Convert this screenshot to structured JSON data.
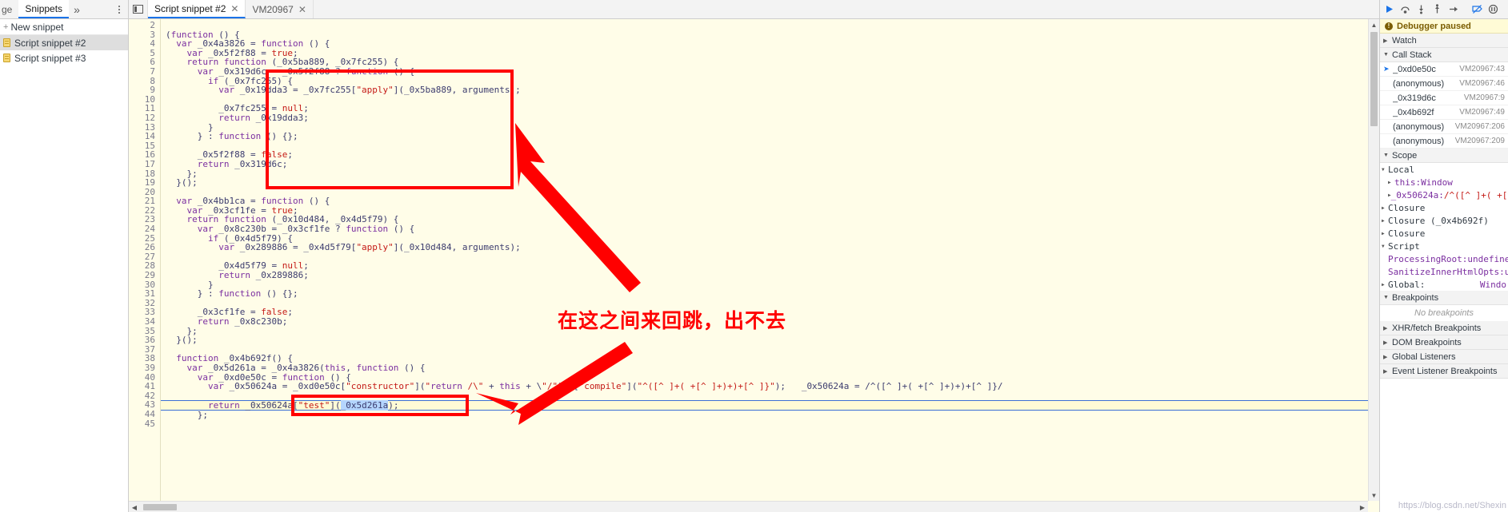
{
  "left_panel": {
    "tabs": [
      {
        "label": "ge",
        "state": "partial"
      },
      {
        "label": "Snippets",
        "state": "selected"
      },
      {
        "label": "»",
        "state": "more"
      }
    ],
    "menu_icon": "vertical-dots-icon",
    "new_snippet_label": "New snippet",
    "new_snippet_plus": "+",
    "snippets": [
      {
        "label": "Script snippet #2",
        "active": true
      },
      {
        "label": "Script snippet #3",
        "active": false
      }
    ]
  },
  "editor": {
    "nav_toggle_icon": "show-navigator-icon",
    "tabs": [
      {
        "label": "Script snippet #2",
        "close": "✕",
        "selected": true
      },
      {
        "label": "VM20967",
        "close": "✕",
        "selected": false
      }
    ],
    "lines": [
      {
        "n": 2,
        "text": ""
      },
      {
        "n": 3,
        "text": "(function () {"
      },
      {
        "n": 4,
        "text": "  var _0x4a3826 = function () {"
      },
      {
        "n": 5,
        "text": "    var _0x5f2f88 = true;"
      },
      {
        "n": 6,
        "text": "    return function (_0x5ba889, _0x7fc255) {"
      },
      {
        "n": 7,
        "text": "      var _0x319d6c = _0x5f2f88 ? function () {"
      },
      {
        "n": 8,
        "text": "        if (_0x7fc255) {"
      },
      {
        "n": 9,
        "text": "          var _0x19dda3 = _0x7fc255[\"apply\"](_0x5ba889, arguments);"
      },
      {
        "n": 10,
        "text": ""
      },
      {
        "n": 11,
        "text": "          _0x7fc255 = null;"
      },
      {
        "n": 12,
        "text": "          return _0x19dda3;"
      },
      {
        "n": 13,
        "text": "        }"
      },
      {
        "n": 14,
        "text": "      } : function () {};"
      },
      {
        "n": 15,
        "text": ""
      },
      {
        "n": 16,
        "text": "      _0x5f2f88 = false;"
      },
      {
        "n": 17,
        "text": "      return _0x319d6c;"
      },
      {
        "n": 18,
        "text": "    };"
      },
      {
        "n": 19,
        "text": "  }();"
      },
      {
        "n": 20,
        "text": ""
      },
      {
        "n": 21,
        "text": "  var _0x4bb1ca = function () {"
      },
      {
        "n": 22,
        "text": "    var _0x3cf1fe = true;"
      },
      {
        "n": 23,
        "text": "    return function (_0x10d484, _0x4d5f79) {"
      },
      {
        "n": 24,
        "text": "      var _0x8c230b = _0x3cf1fe ? function () {"
      },
      {
        "n": 25,
        "text": "        if (_0x4d5f79) {"
      },
      {
        "n": 26,
        "text": "          var _0x289886 = _0x4d5f79[\"apply\"](_0x10d484, arguments);"
      },
      {
        "n": 27,
        "text": ""
      },
      {
        "n": 28,
        "text": "          _0x4d5f79 = null;"
      },
      {
        "n": 29,
        "text": "          return _0x289886;"
      },
      {
        "n": 30,
        "text": "        }"
      },
      {
        "n": 31,
        "text": "      } : function () {};"
      },
      {
        "n": 32,
        "text": ""
      },
      {
        "n": 33,
        "text": "      _0x3cf1fe = false;"
      },
      {
        "n": 34,
        "text": "      return _0x8c230b;"
      },
      {
        "n": 35,
        "text": "    };"
      },
      {
        "n": 36,
        "text": "  }();"
      },
      {
        "n": 37,
        "text": ""
      },
      {
        "n": 38,
        "text": "  function _0x4b692f() {"
      },
      {
        "n": 39,
        "text": "    var _0x5d261a = _0x4a3826(this, function () {"
      },
      {
        "n": 40,
        "text": "      var _0xd0e50c = function () {"
      },
      {
        "n": 41,
        "text": "        var _0x50624a = _0xd0e50c[\"constructor\"](\"return /\\\" + this + \\\"/\")()[\"compile\"](\"^([^ ]+( +[^ ]+)+)+[^ ]}\");   _0x50624a = /^([^ ]+( +[^ ]+)+)+[^ ]}/"
      },
      {
        "n": 42,
        "text": ""
      },
      {
        "n": 43,
        "text": "        return _0x50624a[\"test\"](_0x5d261a);"
      },
      {
        "n": 44,
        "text": "      };"
      },
      {
        "n": 45,
        "text": ""
      }
    ],
    "paused_line": 43,
    "selected_token": "_0x5d261a",
    "scroll": {
      "v_position": "top",
      "h_position": "left"
    }
  },
  "annotations": {
    "note_text": "在这之间来回跳，出不去",
    "color": "#ff0000",
    "boxes": [
      {
        "name": "upper-code-highlight",
        "lines": "7-19"
      },
      {
        "name": "lower-code-highlight",
        "lines": "43"
      }
    ],
    "arrows": [
      {
        "name": "arrow-to-upper-box"
      },
      {
        "name": "arrow-to-lower-box"
      }
    ]
  },
  "debug_sidebar": {
    "toolbar_buttons": [
      {
        "name": "resume-script-execution",
        "icon": "play-icon"
      },
      {
        "name": "step-over-next-call",
        "icon": "step-over-icon"
      },
      {
        "name": "step-into-next-call",
        "icon": "step-into-icon"
      },
      {
        "name": "step-out-of-current",
        "icon": "step-out-icon"
      },
      {
        "name": "step",
        "icon": "step-icon"
      },
      {
        "name": "deactivate-breakpoints",
        "icon": "deactivate-breakpoints-icon"
      },
      {
        "name": "pause-on-exceptions",
        "icon": "pause-on-exceptions-icon"
      }
    ],
    "paused_banner": "Debugger paused",
    "sections": [
      {
        "title": "Watch",
        "expanded": false
      },
      {
        "title": "Call Stack",
        "expanded": true
      },
      {
        "title": "Scope",
        "expanded": true
      },
      {
        "title": "Breakpoints",
        "expanded": true
      },
      {
        "title": "XHR/fetch Breakpoints",
        "expanded": false
      },
      {
        "title": "DOM Breakpoints",
        "expanded": false
      },
      {
        "title": "Global Listeners",
        "expanded": false
      },
      {
        "title": "Event Listener Breakpoints",
        "expanded": false
      }
    ],
    "call_stack": [
      {
        "name": "_0xd0e50c",
        "location": "VM20967:43",
        "current": true
      },
      {
        "name": "(anonymous)",
        "location": "VM20967:46",
        "current": false
      },
      {
        "name": "_0x319d6c",
        "location": "VM20967:9",
        "current": false
      },
      {
        "name": "_0x4b692f",
        "location": "VM20967:49",
        "current": false
      },
      {
        "name": "(anonymous)",
        "location": "VM20967:206",
        "current": false
      },
      {
        "name": "(anonymous)",
        "location": "VM20967:209",
        "current": false
      }
    ],
    "scope": [
      {
        "indent": 0,
        "tri": "down",
        "name": "Local",
        "value": "",
        "kind": "group"
      },
      {
        "indent": 1,
        "tri": "right",
        "name": "this",
        "value": "Window",
        "kind": "prop"
      },
      {
        "indent": 1,
        "tri": "right",
        "name": "_0x50624a",
        "value": "/^([^ ]+( +[^ ]+",
        "kind": "prop"
      },
      {
        "indent": 0,
        "tri": "right",
        "name": "Closure",
        "value": "",
        "kind": "group"
      },
      {
        "indent": 0,
        "tri": "right",
        "name": "Closure (_0x4b692f)",
        "value": "",
        "kind": "group"
      },
      {
        "indent": 0,
        "tri": "right",
        "name": "Closure",
        "value": "",
        "kind": "group"
      },
      {
        "indent": 0,
        "tri": "down",
        "name": "Script",
        "value": "",
        "kind": "group"
      },
      {
        "indent": 1,
        "tri": "none",
        "name": "ProcessingRoot",
        "value": "undefined",
        "kind": "prop"
      },
      {
        "indent": 1,
        "tri": "none",
        "name": "SanitizeInnerHtmlOpts",
        "value": "unde",
        "kind": "prop"
      },
      {
        "indent": 0,
        "tri": "right",
        "name": "Global",
        "value": "Windo",
        "kind": "group"
      }
    ],
    "no_breakpoints_text": "No breakpoints"
  },
  "watermark": "https://blog.csdn.net/Shexin"
}
